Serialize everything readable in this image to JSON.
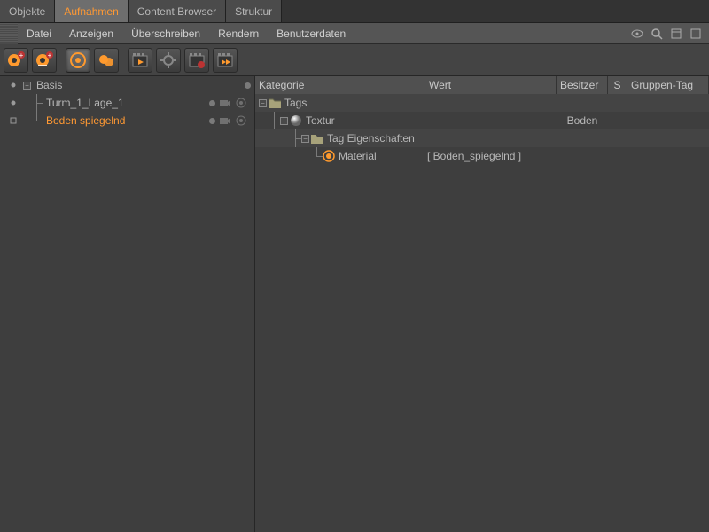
{
  "tabs": [
    "Objekte",
    "Aufnahmen",
    "Content Browser",
    "Struktur"
  ],
  "active_tab_index": 1,
  "menubar": [
    "Datei",
    "Anzeigen",
    "Überschreiben",
    "Rendern",
    "Benutzerdaten"
  ],
  "toolbar_icons": [
    "take-add-1",
    "take-add-2",
    "take-select",
    "take-link",
    "clap-1",
    "gear",
    "clap-2",
    "clap-3"
  ],
  "active_toolbar_index": 2,
  "tree": {
    "root": {
      "label": "Basis",
      "children": [
        {
          "label": "Turm_1_Lage_1"
        },
        {
          "label": "Boden spiegelnd",
          "selected": true
        }
      ]
    }
  },
  "property_headers": {
    "category": "Kategorie",
    "value": "Wert",
    "owner": "Besitzer",
    "s": "S",
    "group_tag": "Gruppen-Tag"
  },
  "property_rows": [
    {
      "depth": 0,
      "icon": "folder",
      "label": "Tags",
      "value": "",
      "owner": "",
      "alt": true
    },
    {
      "depth": 1,
      "icon": "sphere",
      "label": "Textur",
      "value": "",
      "owner": "Boden"
    },
    {
      "depth": 2,
      "icon": "folder",
      "label": "Tag Eigenschaften",
      "value": "",
      "owner": "",
      "alt": true
    },
    {
      "depth": 3,
      "icon": "material",
      "label": "Material",
      "value": "[ Boden_spiegelnd ]",
      "owner": ""
    }
  ]
}
